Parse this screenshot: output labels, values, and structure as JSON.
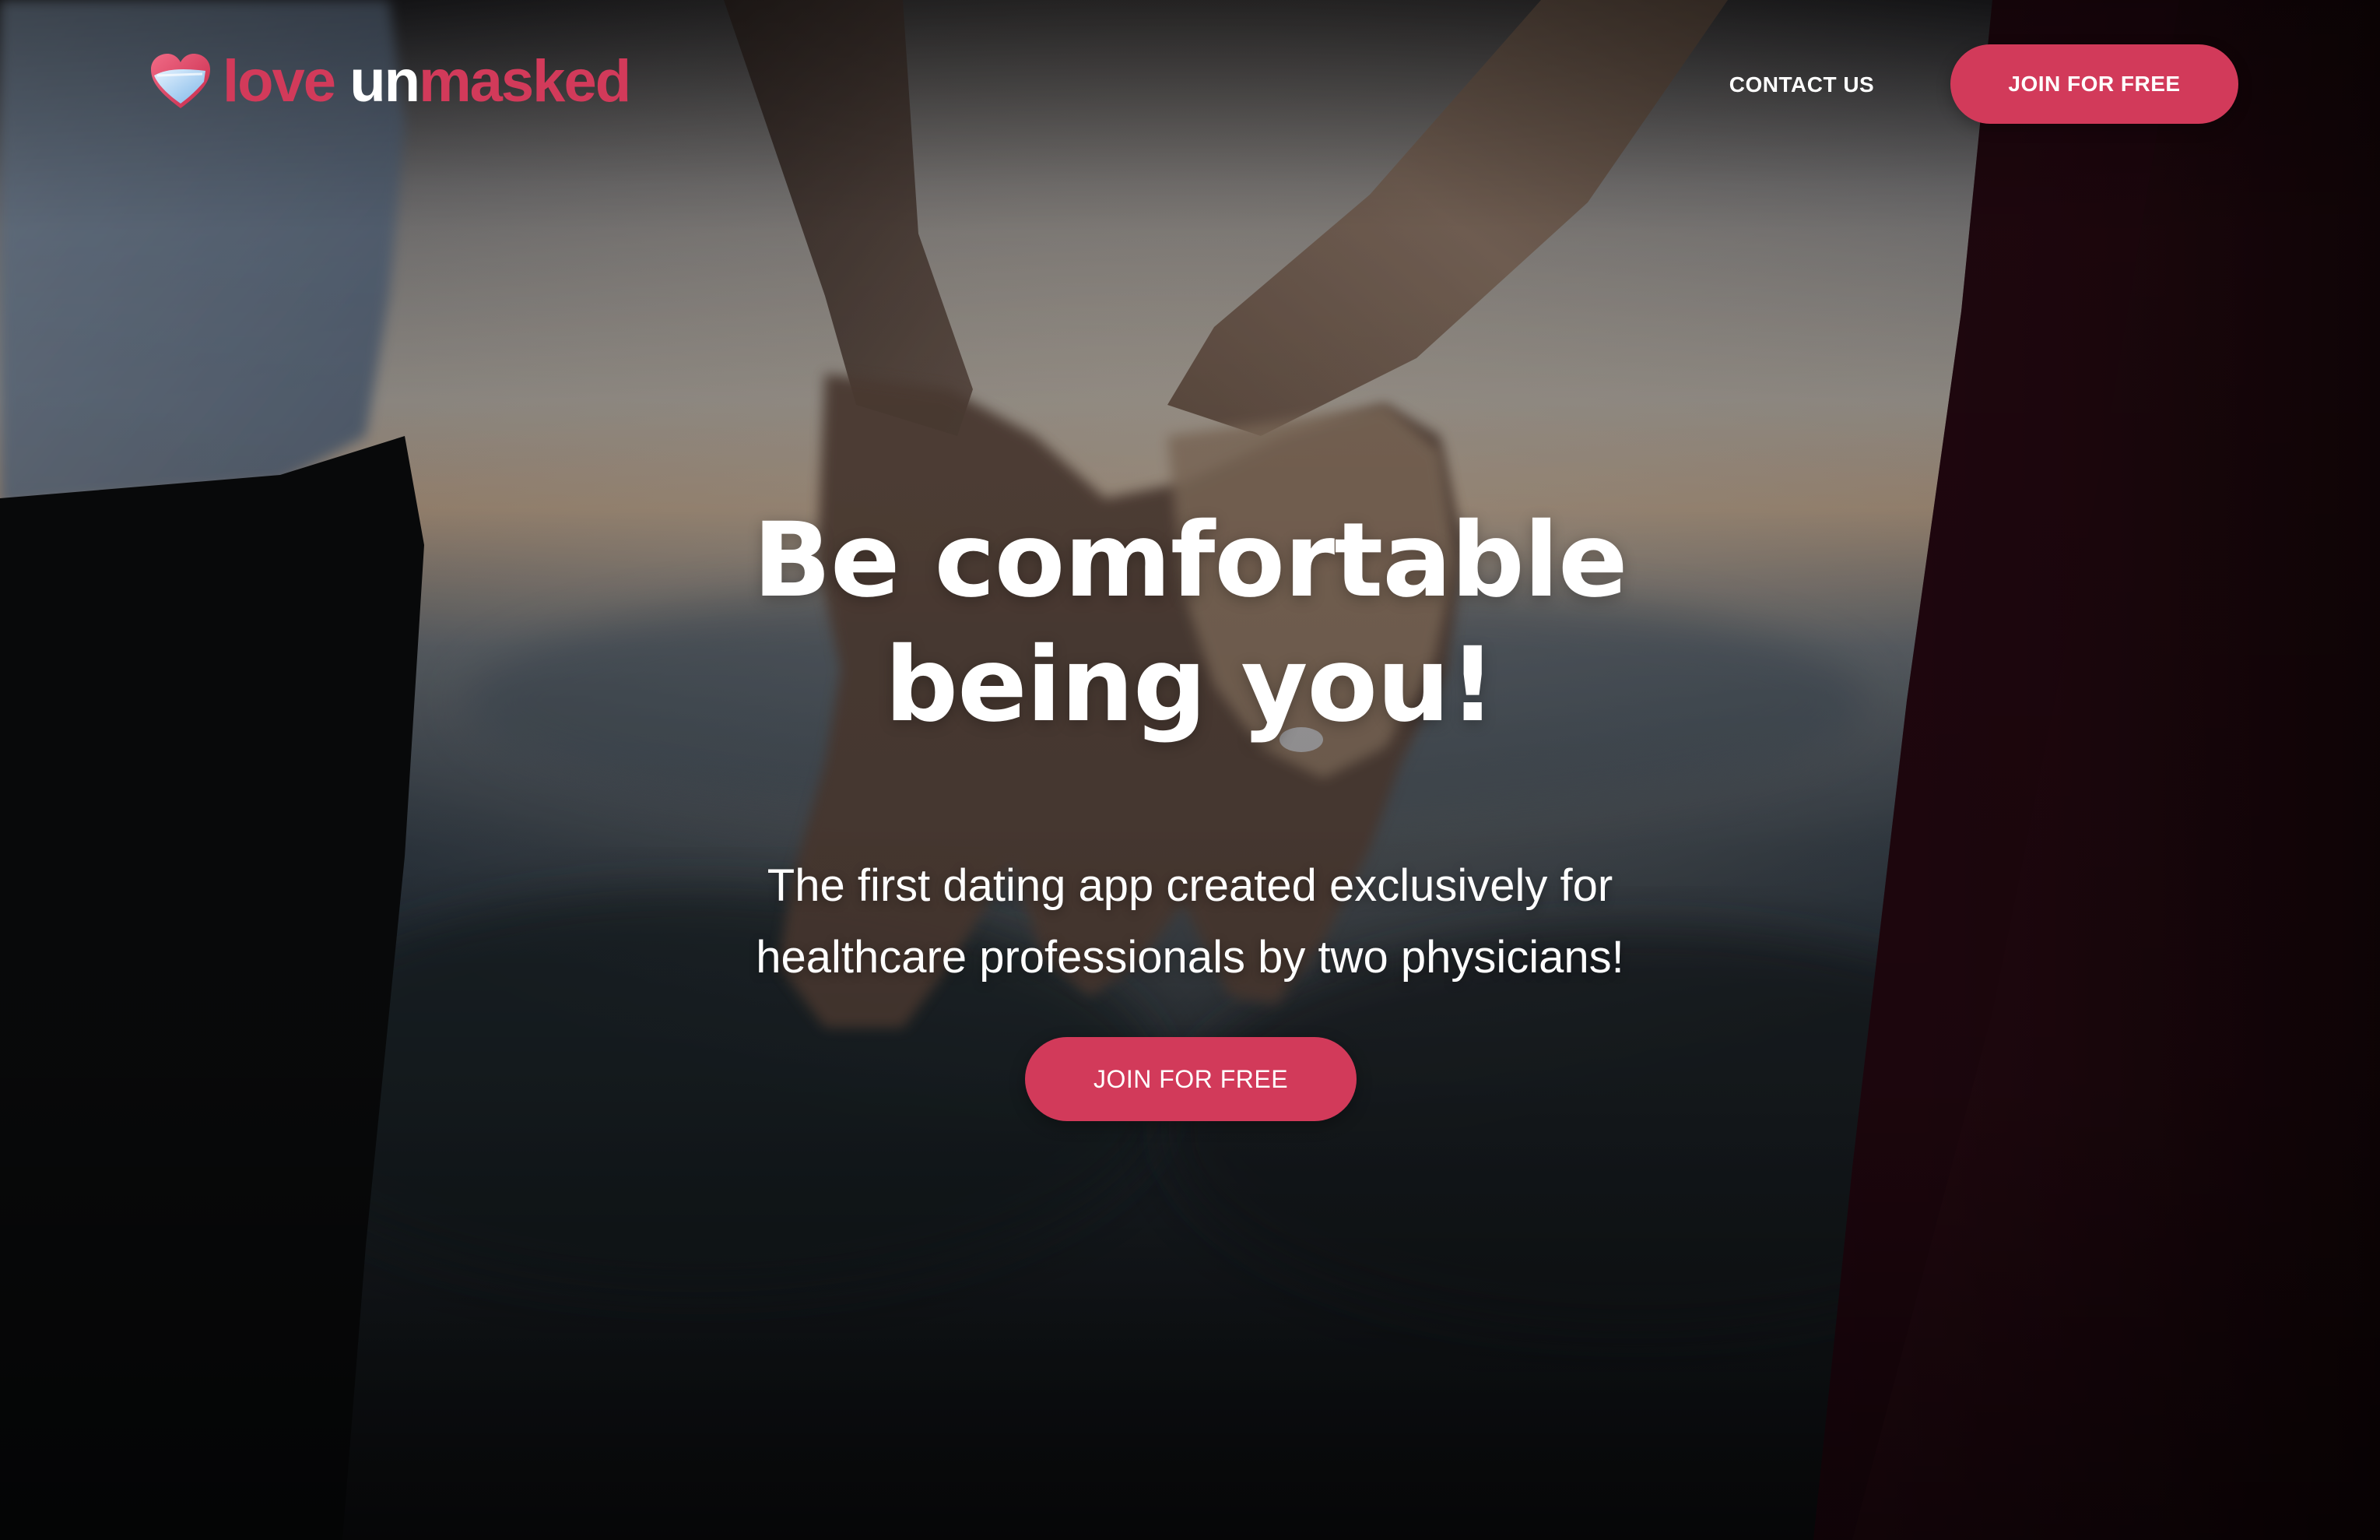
{
  "brand": {
    "name_part1": "love ",
    "name_part2": "un",
    "name_part3": "masked",
    "icon": "heart-mask-icon",
    "accent_color": "#d23a5a"
  },
  "nav": {
    "contact_label": "CONTACT US",
    "join_label": "JOIN FOR FREE"
  },
  "hero": {
    "title_line1": "Be comfortable",
    "title_line2": "being you!",
    "subtitle_line1": "The first dating app created exclusively for",
    "subtitle_line2": "healthcare professionals by two physicians!",
    "cta_label": "JOIN FOR FREE",
    "background_image": "hero-photo-holding-hands"
  }
}
